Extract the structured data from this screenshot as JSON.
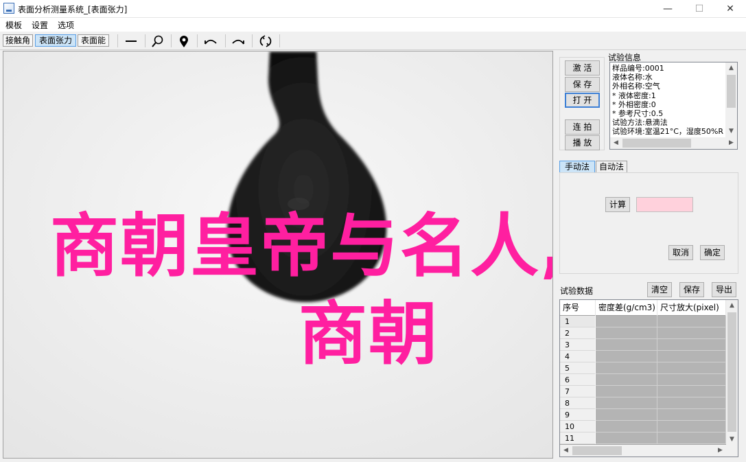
{
  "window": {
    "title": "表面分析测量系统_[表面张力]",
    "min": "—",
    "max": "☐",
    "close": "✕"
  },
  "menu": [
    "模板",
    "设置",
    "选项"
  ],
  "toolbar": {
    "modes": [
      "接触角",
      "表面张力",
      "表面能"
    ],
    "active_mode": 1
  },
  "watermark": {
    "line1": "商朝皇帝与名人,",
    "line2": "商朝"
  },
  "buttons": {
    "activate": "激 活",
    "save": "保 存",
    "open": "打 开",
    "continuous": "连 拍",
    "play": "播 放"
  },
  "info": {
    "label": "试验信息",
    "lines": [
      "样品编号:0001",
      "液体名称:水",
      "外相名称:空气",
      "* 液体密度:1",
      "* 外相密度:0",
      "* 参考尺寸:0.5",
      "试验方法:悬滴法",
      "试验环境:室温21°C，湿度50%R"
    ]
  },
  "calc_tabs": [
    "手动法",
    "自动法"
  ],
  "calc": {
    "compute": "计算",
    "cancel": "取消",
    "confirm": "确定"
  },
  "data": {
    "label": "试验数据",
    "clear": "清空",
    "save": "保存",
    "export": "导出",
    "columns": [
      "序号",
      "密度差(g/cm3)",
      "尺寸放大(pixel)"
    ],
    "rows": [
      "1",
      "2",
      "3",
      "4",
      "5",
      "6",
      "7",
      "8",
      "9",
      "10",
      "11"
    ]
  }
}
